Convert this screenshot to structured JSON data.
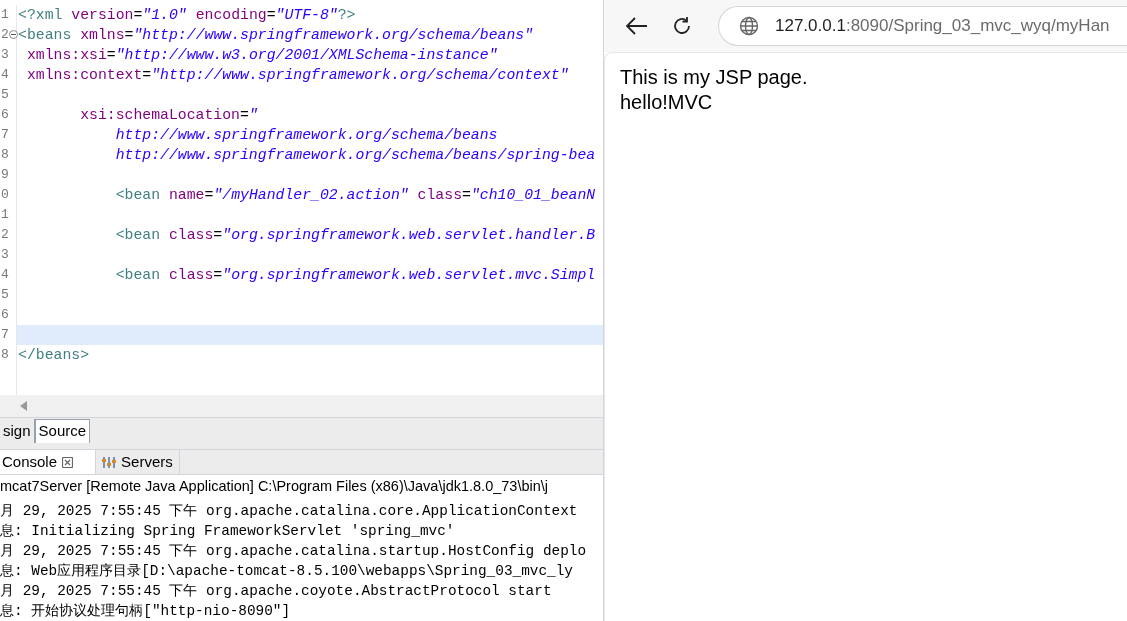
{
  "editor": {
    "lines": [
      {
        "number": "1",
        "current": false,
        "fold": false,
        "segments": [
          {
            "kind": "tag",
            "text": "<?xml "
          },
          {
            "kind": "attr",
            "text": "version"
          },
          {
            "kind": "plain",
            "text": "="
          },
          {
            "kind": "value",
            "text": "\"1.0\" "
          },
          {
            "kind": "attr",
            "text": "encoding"
          },
          {
            "kind": "plain",
            "text": "="
          },
          {
            "kind": "value",
            "text": "\"UTF-8\""
          },
          {
            "kind": "tag",
            "text": "?>"
          }
        ]
      },
      {
        "number": "2",
        "current": false,
        "fold": true,
        "segments": [
          {
            "kind": "tag",
            "text": "<beans "
          },
          {
            "kind": "attr",
            "text": "xmlns"
          },
          {
            "kind": "plain",
            "text": "="
          },
          {
            "kind": "value",
            "text": "\"http://www.springframework.org/schema/beans\""
          }
        ]
      },
      {
        "number": "3",
        "current": false,
        "fold": false,
        "segments": [
          {
            "kind": "attr",
            "text": " xmlns:xsi"
          },
          {
            "kind": "plain",
            "text": "="
          },
          {
            "kind": "value",
            "text": "\"http://www.w3.org/2001/XMLSchema-instance\""
          }
        ]
      },
      {
        "number": "4",
        "current": false,
        "fold": false,
        "segments": [
          {
            "kind": "attr",
            "text": " xmlns:context"
          },
          {
            "kind": "plain",
            "text": "="
          },
          {
            "kind": "value",
            "text": "\"http://www.springframework.org/schema/context\""
          }
        ]
      },
      {
        "number": "5",
        "current": false,
        "fold": false
      },
      {
        "number": "6",
        "current": false,
        "fold": false,
        "segments": [
          {
            "kind": "attr",
            "text": "       xsi:schemaLocation"
          },
          {
            "kind": "plain",
            "text": "="
          },
          {
            "kind": "value",
            "text": "\""
          }
        ]
      },
      {
        "number": "7",
        "current": false,
        "fold": false,
        "segments": [
          {
            "kind": "value",
            "text": "           http://www.springframework.org/schema/beans"
          }
        ]
      },
      {
        "number": "8",
        "current": false,
        "fold": false,
        "segments": [
          {
            "kind": "value",
            "text": "           http://www.springframework.org/schema/beans/spring-bea"
          }
        ]
      },
      {
        "number": "9",
        "current": false,
        "fold": false
      },
      {
        "number": "0",
        "current": false,
        "fold": false,
        "segments": [
          {
            "kind": "tag",
            "text": "           <bean "
          },
          {
            "kind": "attr",
            "text": "name"
          },
          {
            "kind": "plain",
            "text": "="
          },
          {
            "kind": "value",
            "text": "\"/myHandler_02.action\" "
          },
          {
            "kind": "attr",
            "text": "class"
          },
          {
            "kind": "plain",
            "text": "="
          },
          {
            "kind": "value",
            "text": "\"ch10_01_beanN"
          }
        ]
      },
      {
        "number": "1",
        "current": false,
        "fold": false
      },
      {
        "number": "2",
        "current": false,
        "fold": false,
        "segments": [
          {
            "kind": "tag",
            "text": "           <bean "
          },
          {
            "kind": "attr",
            "text": "class"
          },
          {
            "kind": "plain",
            "text": "="
          },
          {
            "kind": "value",
            "text": "\"org.springframework.web.servlet.handler.B"
          }
        ]
      },
      {
        "number": "3",
        "current": false,
        "fold": false
      },
      {
        "number": "4",
        "current": false,
        "fold": false,
        "segments": [
          {
            "kind": "tag",
            "text": "           <bean "
          },
          {
            "kind": "attr",
            "text": "class"
          },
          {
            "kind": "plain",
            "text": "="
          },
          {
            "kind": "value",
            "text": "\"org.springframework.web.servlet.mvc.Simpl"
          }
        ]
      },
      {
        "number": "5",
        "current": false,
        "fold": false
      },
      {
        "number": "6",
        "current": false,
        "fold": false
      },
      {
        "number": "7",
        "current": true,
        "fold": false
      },
      {
        "number": "8",
        "current": false,
        "fold": false,
        "segments": [
          {
            "kind": "tag",
            "text": "</beans>"
          }
        ]
      }
    ]
  },
  "editor_tabs": [
    {
      "label": "sign",
      "selected": false
    },
    {
      "label": "Source",
      "selected": true
    }
  ],
  "console": {
    "tabs": [
      {
        "label": "Console",
        "kind": "console",
        "selected": true
      },
      {
        "label": "Servers",
        "kind": "servers",
        "selected": false
      }
    ],
    "title": "mcat7Server [Remote Java Application] C:\\Program Files (x86)\\Java\\jdk1.8.0_73\\bin\\j",
    "lines": [
      "月 29, 2025 7:55:45 下午 org.apache.catalina.core.ApplicationContext",
      "息: Initializing Spring FrameworkServlet 'spring_mvc'",
      "月 29, 2025 7:55:45 下午 org.apache.catalina.startup.HostConfig deplo",
      "息: Web应用程序目录[D:\\apache-tomcat-8.5.100\\webapps\\Spring_03_mvc_ly",
      "月 29, 2025 7:55:45 下午 org.apache.coyote.AbstractProtocol start",
      "息: 开始协议处理句柄[\"http-nio-8090\"]"
    ]
  },
  "browser": {
    "url_host": "127.0.0.1",
    "url_rest": ":8090/Spring_03_mvc_wyq/myHan",
    "page_lines": [
      "This is my JSP page.",
      "hello!MVC"
    ]
  }
}
